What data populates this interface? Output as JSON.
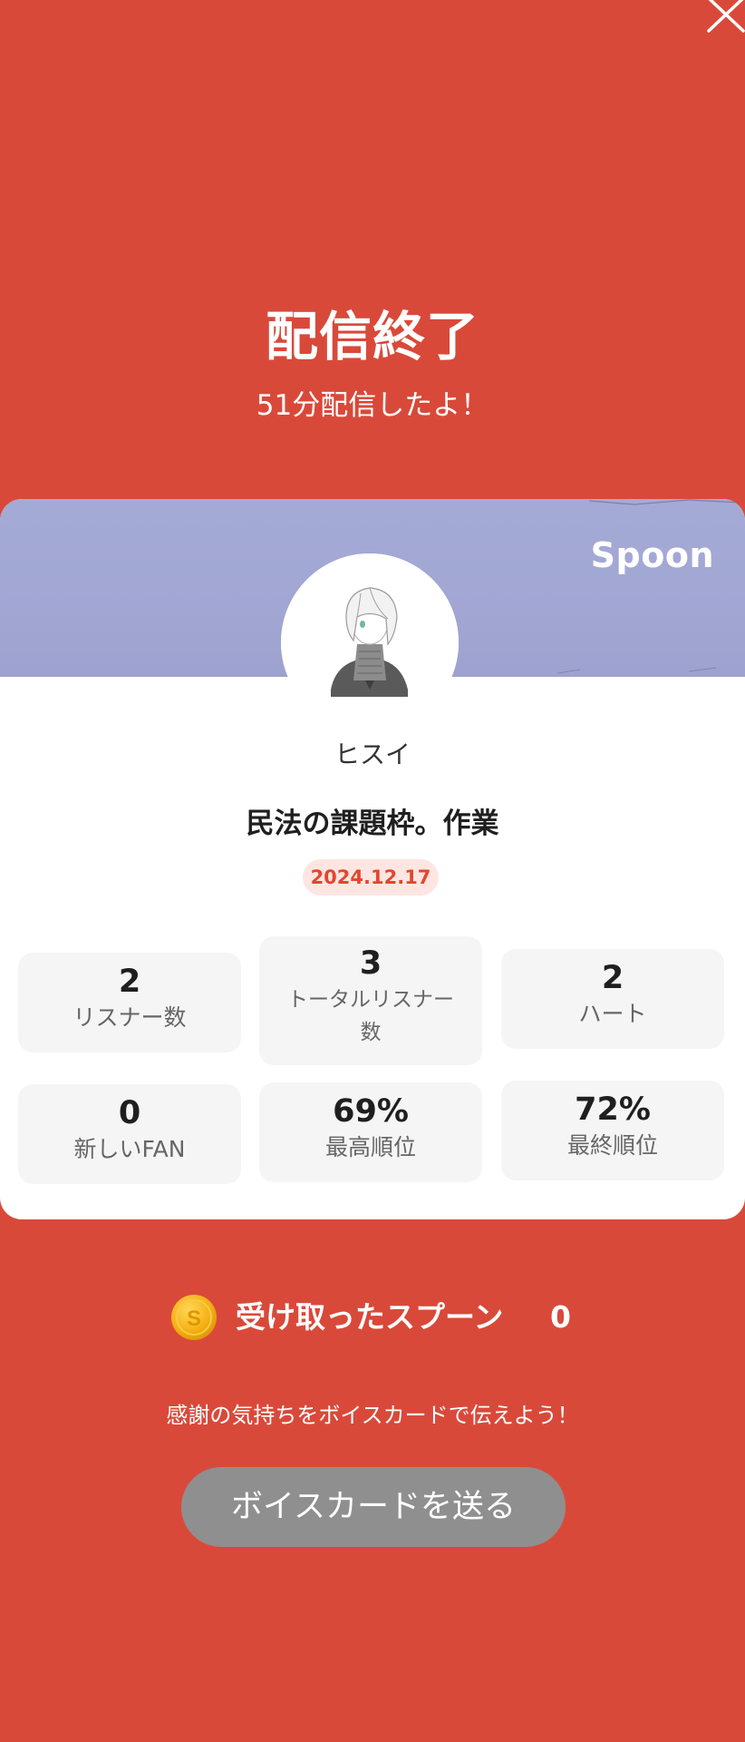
{
  "header": {
    "close_icon": "close-icon",
    "title": "配信終了",
    "subtitle": "51分配信したよ！"
  },
  "card": {
    "brand": "Spoon",
    "avatar_icon": "profile-avatar-drawing",
    "username": "ヒスイ",
    "stream_title": "民法の課題枠。作業",
    "date": "2024.12.17",
    "stats": [
      {
        "value": "2",
        "label": "リスナー数"
      },
      {
        "value": "3",
        "label_line1": "トータルリスナー",
        "label_line2": "数"
      },
      {
        "value": "2",
        "label": "ハート"
      },
      {
        "value": "0",
        "label": "新しいFAN"
      },
      {
        "value": "69%",
        "label": "最高順位"
      },
      {
        "value": "72%",
        "label": "最終順位"
      }
    ]
  },
  "spoons": {
    "coin_icon": "spoon-coin-icon",
    "coin_letter": "S",
    "label": "受け取ったスプーン",
    "count": "0"
  },
  "footer": {
    "thanks": "感謝の気持ちをボイスカードで伝えよう！",
    "button_label": "ボイスカードを送る"
  },
  "colors": {
    "background": "#d9493a",
    "card": "#ffffff",
    "banner": "#a2a7d4",
    "date_badge_bg": "#fde6e1",
    "date_badge_text": "#e4462e",
    "stat_bg": "#f5f5f5",
    "button_bg": "#8f8f8f",
    "coin": "#f5b014"
  }
}
